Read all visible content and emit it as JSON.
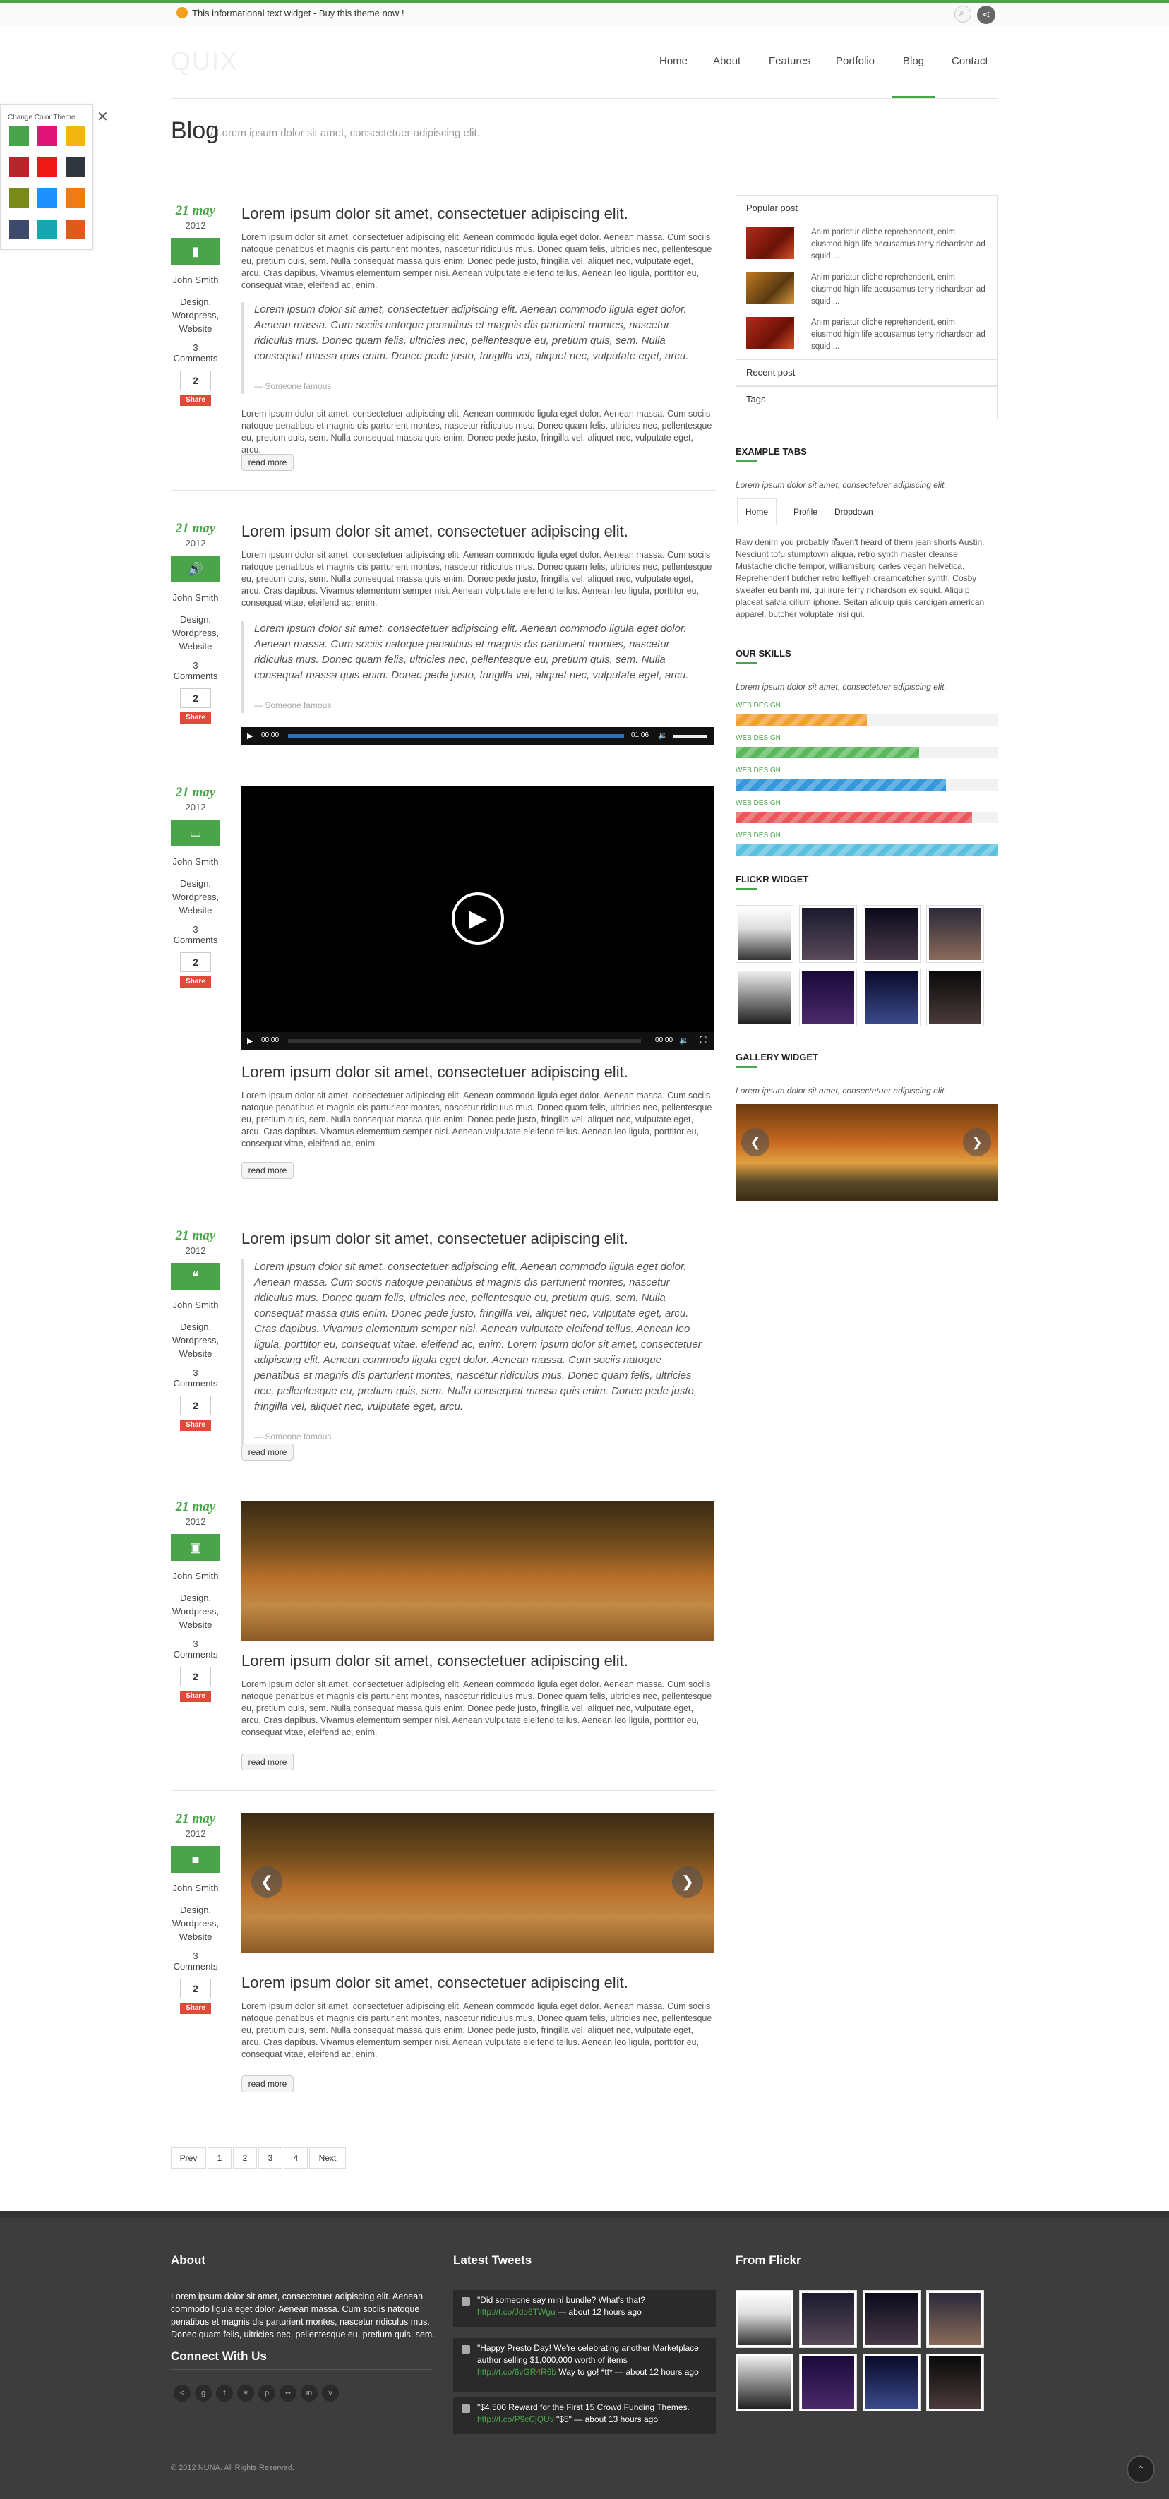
{
  "topbar": {
    "message": "This informational text widget - Buy this theme now !"
  },
  "logo": "QUIX",
  "nav": {
    "items": [
      "Home",
      "About",
      "Features",
      "Portfolio",
      "Blog",
      "Contact"
    ],
    "active": "Blog"
  },
  "color_panel": {
    "title": "Change Color Theme",
    "swatches": [
      "#4aa54a",
      "#e0157a",
      "#f3b512",
      "#b5262c",
      "#f01717",
      "#30363e",
      "#7a8a1a",
      "#1e90ff",
      "#f27a14",
      "#3d4a6b",
      "#17a6b0",
      "#e05a1a"
    ]
  },
  "page": {
    "title": "Blog",
    "subtitle": "/ Lorem ipsum dolor sit amet, consectetuer adipiscing elit."
  },
  "posts": [
    {
      "day": "21 may",
      "year": "2012",
      "author": "John Smith",
      "cats": "Design, Wordpress, Website",
      "comments": "3 Comments",
      "count": "2",
      "share": "Share",
      "title": "Lorem ipsum dolor sit amet, consectetuer adipiscing elit.",
      "body": "Lorem ipsum dolor sit amet, consectetuer adipiscing elit. Aenean commodo ligula eget dolor. Aenean massa. Cum sociis natoque penatibus et magnis dis parturient montes, nascetur ridiculus mus. Donec quam felis, ultricies nec, pellentesque eu, pretium quis, sem. Nulla consequat massa quis enim. Donec pede justo, fringilla vel, aliquet nec, vulputate eget, arcu. Cras dapibus. Vivamus elementum semper nisi. Aenean vulputate eleifend tellus. Aenean leo ligula, porttitor eu, consequat vitae, eleifend ac, enim.",
      "quote": "Lorem ipsum dolor sit amet, consectetuer adipiscing elit. Aenean commodo ligula eget dolor. Aenean massa. Cum sociis natoque penatibus et magnis dis parturient montes, nascetur ridiculus mus. Donec quam felis, ultricies nec, pellentesque eu, pretium quis, sem. Nulla consequat massa quis enim. Donec pede justo, fringilla vel, aliquet nec, vulputate eget, arcu.",
      "quote_by": "— Someone famous",
      "body2": "Lorem ipsum dolor sit amet, consectetuer adipiscing elit. Aenean commodo ligula eget dolor. Aenean massa. Cum sociis natoque penatibus et magnis dis parturient montes, nascetur ridiculus mus. Donec quam felis, ultricies nec, pellentesque eu, pretium quis, sem. Nulla consequat massa quis enim. Donec pede justo, fringilla vel, aliquet nec, vulputate eget, arcu.",
      "readmore": "read more"
    },
    {
      "day": "21 may",
      "year": "2012",
      "author": "John Smith",
      "cats": "Design, Wordpress, Website",
      "comments": "3 Comments",
      "count": "2",
      "share": "Share",
      "title": "Lorem ipsum dolor sit amet, consectetuer adipiscing elit.",
      "body": "Lorem ipsum dolor sit amet, consectetuer adipiscing elit. Aenean commodo ligula eget dolor. Aenean massa. Cum sociis natoque penatibus et magnis dis parturient montes, nascetur ridiculus mus. Donec quam felis, ultricies nec, pellentesque eu, pretium quis, sem. Nulla consequat massa quis enim. Donec pede justo, fringilla vel, aliquet nec, vulputate eget, arcu. Cras dapibus. Vivamus elementum semper nisi. Aenean vulputate eleifend tellus. Aenean leo ligula, porttitor eu, consequat vitae, eleifend ac, enim.",
      "quote": "Lorem ipsum dolor sit amet, consectetuer adipiscing elit. Aenean commodo ligula eget dolor. Aenean massa. Cum sociis natoque penatibus et magnis dis parturient montes, nascetur ridiculus mus. Donec quam felis, ultricies nec, pellentesque eu, pretium quis, sem. Nulla consequat massa quis enim. Donec pede justo, fringilla vel, aliquet nec, vulputate eget, arcu.",
      "quote_by": "— Someone famous",
      "audio_start": "00:00",
      "audio_end": "01:06"
    },
    {
      "day": "21 may",
      "year": "2012",
      "author": "John Smith",
      "cats": "Design, Wordpress, Website",
      "comments": "3 Comments",
      "count": "2",
      "share": "Share",
      "video_start": "00:00",
      "video_end": "00:00",
      "title": "Lorem ipsum dolor sit amet, consectetuer adipiscing elit.",
      "body": "Lorem ipsum dolor sit amet, consectetuer adipiscing elit. Aenean commodo ligula eget dolor. Aenean massa. Cum sociis natoque penatibus et magnis dis parturient montes, nascetur ridiculus mus. Donec quam felis, ultricies nec, pellentesque eu, pretium quis, sem. Nulla consequat massa quis enim. Donec pede justo, fringilla vel, aliquet nec, vulputate eget, arcu. Cras dapibus. Vivamus elementum semper nisi. Aenean vulputate eleifend tellus. Aenean leo ligula, porttitor eu, consequat vitae, eleifend ac, enim.",
      "readmore": "read more"
    },
    {
      "day": "21 may",
      "year": "2012",
      "author": "John Smith",
      "cats": "Design, Wordpress, Website",
      "comments": "3 Comments",
      "count": "2",
      "share": "Share",
      "title": "Lorem ipsum dolor sit amet, consectetuer adipiscing elit.",
      "quote": "Lorem ipsum dolor sit amet, consectetuer adipiscing elit. Aenean commodo ligula eget dolor. Aenean massa. Cum sociis natoque penatibus et magnis dis parturient montes, nascetur ridiculus mus. Donec quam felis, ultricies nec, pellentesque eu, pretium quis, sem. Nulla consequat massa quis enim. Donec pede justo, fringilla vel, aliquet nec, vulputate eget, arcu. Cras dapibus. Vivamus elementum semper nisi. Aenean vulputate eleifend tellus. Aenean leo ligula, porttitor eu, consequat vitae, eleifend ac, enim. Lorem ipsum dolor sit amet, consectetuer adipiscing elit. Aenean commodo ligula eget dolor. Aenean massa. Cum sociis natoque penatibus et magnis dis parturient montes, nascetur ridiculus mus. Donec quam felis, ultricies nec, pellentesque eu, pretium quis, sem. Nulla consequat massa quis enim. Donec pede justo, fringilla vel, aliquet nec, vulputate eget, arcu.",
      "quote_by": "— Someone famous",
      "readmore": "read more"
    },
    {
      "day": "21 may",
      "year": "2012",
      "author": "John Smith",
      "cats": "Design, Wordpress, Website",
      "comments": "3 Comments",
      "count": "2",
      "share": "Share",
      "title": "Lorem ipsum dolor sit amet, consectetuer adipiscing elit.",
      "body": "Lorem ipsum dolor sit amet, consectetuer adipiscing elit. Aenean commodo ligula eget dolor. Aenean massa. Cum sociis natoque penatibus et magnis dis parturient montes, nascetur ridiculus mus. Donec quam felis, ultricies nec, pellentesque eu, pretium quis, sem. Nulla consequat massa quis enim. Donec pede justo, fringilla vel, aliquet nec, vulputate eget, arcu. Cras dapibus. Vivamus elementum semper nisi. Aenean vulputate eleifend tellus. Aenean leo ligula, porttitor eu, consequat vitae, eleifend ac, enim.",
      "readmore": "read more"
    },
    {
      "day": "21 may",
      "year": "2012",
      "author": "John Smith",
      "cats": "Design, Wordpress, Website",
      "comments": "3 Comments",
      "count": "2",
      "share": "Share",
      "title": "Lorem ipsum dolor sit amet, consectetuer adipiscing elit.",
      "body": "Lorem ipsum dolor sit amet, consectetuer adipiscing elit. Aenean commodo ligula eget dolor. Aenean massa. Cum sociis natoque penatibus et magnis dis parturient montes, nascetur ridiculus mus. Donec quam felis, ultricies nec, pellentesque eu, pretium quis, sem. Nulla consequat massa quis enim. Donec pede justo, fringilla vel, aliquet nec, vulputate eget, arcu. Cras dapibus. Vivamus elementum semper nisi. Aenean vulputate eleifend tellus. Aenean leo ligula, porttitor eu, consequat vitae, eleifend ac, enim.",
      "readmore": "read more"
    }
  ],
  "pagination": [
    "Prev",
    "1",
    "2",
    "3",
    "4",
    "Next"
  ],
  "sidebar": {
    "tabs": {
      "popular": "Popular post",
      "recent": "Recent post",
      "tags": "Tags"
    },
    "popular_text": "Anim pariatur cliche reprehenderit, enim eiusmod high life accusamus terry richardson ad squid ...",
    "example_tabs": {
      "title": "EXAMPLE TABS",
      "sub": "Lorem ipsum dolor sit amet, consectetuer adipiscing elit.",
      "tabs": [
        "Home",
        "Profile",
        "Dropdown"
      ],
      "body": "Raw denim you probably haven't heard of them jean shorts Austin. Nesciunt tofu stumptown aliqua, retro synth master cleanse. Mustache cliche tempor, williamsburg carles vegan helvetica. Reprehenderit butcher retro keffiyeh dreamcatcher synth. Cosby sweater eu banh mi, qui irure terry richardson ex squid. Aliquip placeat salvia cillum iphone. Seitan aliquip quis cardigan american apparel, butcher voluptate nisi qui."
    },
    "skills": {
      "title": "OUR SKILLS",
      "sub": "Lorem ipsum dolor sit amet, consectetuer adipiscing elit.",
      "items": [
        {
          "label": "WEB DESIGN",
          "level": 0.5,
          "color": "#f0a030"
        },
        {
          "label": "WEB DESIGN",
          "level": 0.7,
          "color": "#5cb85c"
        },
        {
          "label": "WEB DESIGN",
          "level": 0.8,
          "color": "#3498db"
        },
        {
          "label": "WEB DESIGN",
          "level": 0.9,
          "color": "#e9575a"
        },
        {
          "label": "WEB DESIGN",
          "level": 1.0,
          "color": "#5bc0de"
        }
      ]
    },
    "flickr_title": "FLICKR WIDGET",
    "gallery": {
      "title": "GALLERY WIDGET",
      "sub": "Lorem ipsum dolor sit amet, consectetuer adipiscing elit."
    }
  },
  "footer": {
    "about_title": "About",
    "about_text": "Lorem ipsum dolor sit amet, consectetuer adipiscing elit. Aenean commodo ligula eget dolor. Aenean massa. Cum sociis natoque penatibus et magnis dis parturient montes, nascetur ridiculus mus. Donec quam felis, ultricies nec, pellentesque eu, pretium quis, sem.",
    "connect_title": "Connect With Us",
    "social": [
      "<",
      "g",
      "f",
      "✶",
      "p",
      "••",
      "in",
      "v"
    ],
    "tweets_title": "Latest Tweets",
    "tweets": [
      {
        "text": "\"Did someone say mini bundle? What's that?",
        "link": "http://t.co/Jdo6TWgu",
        "time": "about 12 hours ago"
      },
      {
        "text": "\"Happy Presto Day! We're celebrating another Marketplace author selling $1,000,000 worth of items",
        "link": "http://t.co/6vGR4R6b",
        "tail": "Way to go! *tt*",
        "time": "about 12 hours ago"
      },
      {
        "text": "\"$4,500 Reward for the First 15 Crowd Funding Themes.",
        "link": "http://t.co/P9cCjQUv",
        "tail": "\"$5\"",
        "time": "about 13 hours ago"
      }
    ],
    "flickr_title": "From Flickr",
    "copyright": "© 2012 NUNA. All Rights Reserved."
  }
}
